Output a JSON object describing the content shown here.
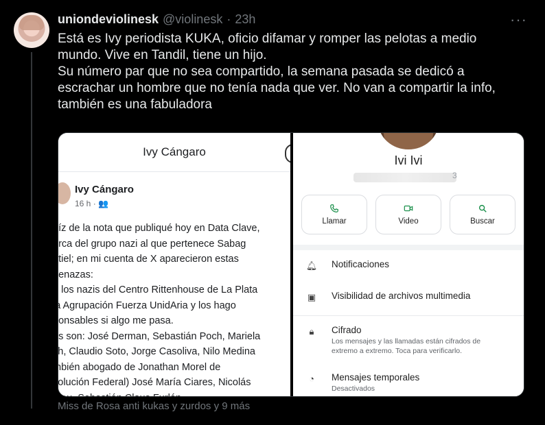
{
  "tweet": {
    "display_name": "uniondeviolinesk",
    "handle": "@violinesk",
    "separator": "·",
    "time": "23h",
    "more_label": "···",
    "text_lines": [
      "Está es Ivy periodista KUKA, oficio difamar y romper las pelotas a medio",
      "mundo. Vive en Tandil, tiene un hijo.",
      "Su número par que no sea compartido, la semana pasada se dedicó a",
      "escrachar un hombre que no tenía nada que ver.  No van a compartir la info,",
      "también es una fabuladora"
    ],
    "liked_by": "Miss de Rosa anti kukas y zurdos y 9 más"
  },
  "media_left": {
    "page_title": "Ivy Cángaro",
    "post_author": "Ivy Cángaro",
    "post_meta": "16 h · 👥",
    "post_lines": [
      "aíz de la nota que publiqué hoy en Data Clave,",
      "erca del grupo nazi al que pertenece Sabag",
      "ntiel; en mi cuenta de X aparecieron estas",
      "nenazas:",
      "n los nazis del Centro Rittenhouse de La Plata",
      "la Agrupación Fuerza UnidAria y los hago",
      "ponsables si algo me pasa.",
      "os son: José Derman, Sebastián Poch, Mariela",
      "ch, Claudio Soto, Jorge Casoliva, Nilo Medina",
      "mbién abogado de Jonathan Morel de",
      "volución Federal) José María Ciares, Nicolás",
      "rcau, Sebastián Claus Furlán."
    ]
  },
  "media_right": {
    "contact_name": "Ivi Ivi",
    "number_tail": "3",
    "actions": [
      {
        "label": "Llamar",
        "icon": "phone-icon"
      },
      {
        "label": "Video",
        "icon": "video-icon"
      },
      {
        "label": "Buscar",
        "icon": "search-icon"
      }
    ],
    "settings": [
      {
        "title": "Notificaciones",
        "subtitle": "",
        "icon": "bell-icon"
      },
      {
        "title": "Visibilidad de archivos multimedia",
        "subtitle": "",
        "icon": "image-icon"
      },
      {
        "title": "Cifrado",
        "subtitle": "Los mensajes y las llamadas están cifrados de extremo a extremo. Toca para verificarlo.",
        "icon": "lock-icon"
      },
      {
        "title": "Mensajes temporales",
        "subtitle": "Desactivados",
        "icon": "timer-icon"
      }
    ],
    "accent_color": "#1a8f4a"
  }
}
